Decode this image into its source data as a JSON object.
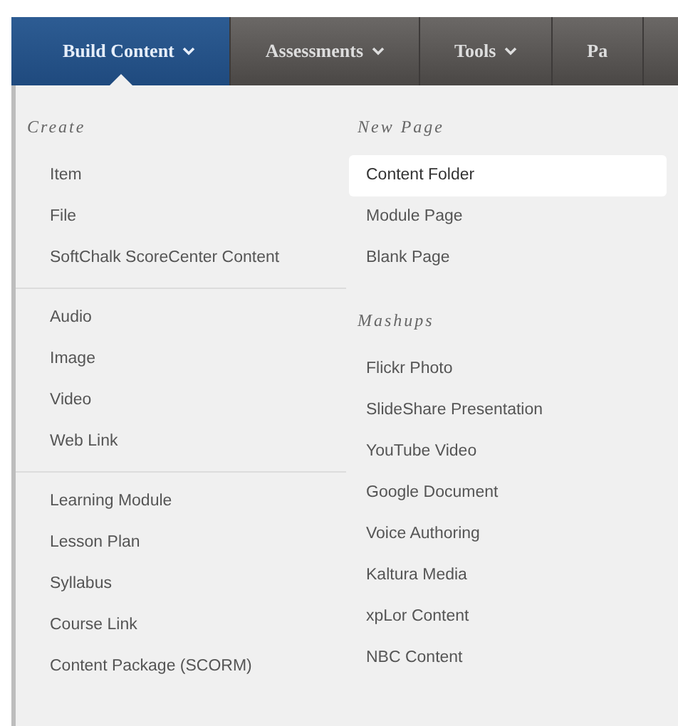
{
  "tabs": [
    {
      "label": "Build Content",
      "selected": true,
      "caret": true
    },
    {
      "label": "Assessments",
      "selected": false,
      "caret": true
    },
    {
      "label": "Tools",
      "selected": false,
      "caret": true
    },
    {
      "label": "Pa",
      "selected": false,
      "caret": false
    }
  ],
  "menu": {
    "columns": [
      {
        "sections": [
          {
            "heading": "Create",
            "items": [
              {
                "label": "Item",
                "selected": false
              },
              {
                "label": "File",
                "selected": false
              },
              {
                "label": "SoftChalk ScoreCenter Content",
                "selected": false
              }
            ]
          },
          {
            "items": [
              {
                "label": "Audio",
                "selected": false
              },
              {
                "label": "Image",
                "selected": false
              },
              {
                "label": "Video",
                "selected": false
              },
              {
                "label": "Web Link",
                "selected": false
              }
            ]
          },
          {
            "items": [
              {
                "label": "Learning Module",
                "selected": false
              },
              {
                "label": "Lesson Plan",
                "selected": false
              },
              {
                "label": "Syllabus",
                "selected": false
              },
              {
                "label": "Course Link",
                "selected": false
              },
              {
                "label": "Content Package (SCORM)",
                "selected": false
              }
            ]
          }
        ]
      },
      {
        "sections": [
          {
            "heading": "New Page",
            "items": [
              {
                "label": "Content Folder",
                "selected": true
              },
              {
                "label": "Module Page",
                "selected": false
              },
              {
                "label": "Blank Page",
                "selected": false
              }
            ]
          },
          {
            "heading": "Mashups",
            "items": [
              {
                "label": "Flickr Photo",
                "selected": false
              },
              {
                "label": "SlideShare Presentation",
                "selected": false
              },
              {
                "label": "YouTube Video",
                "selected": false
              },
              {
                "label": "Google Document",
                "selected": false
              },
              {
                "label": "Voice Authoring",
                "selected": false
              },
              {
                "label": "Kaltura Media",
                "selected": false
              },
              {
                "label": "xpLor Content",
                "selected": false
              },
              {
                "label": "NBC Content",
                "selected": false
              }
            ]
          }
        ]
      }
    ]
  }
}
